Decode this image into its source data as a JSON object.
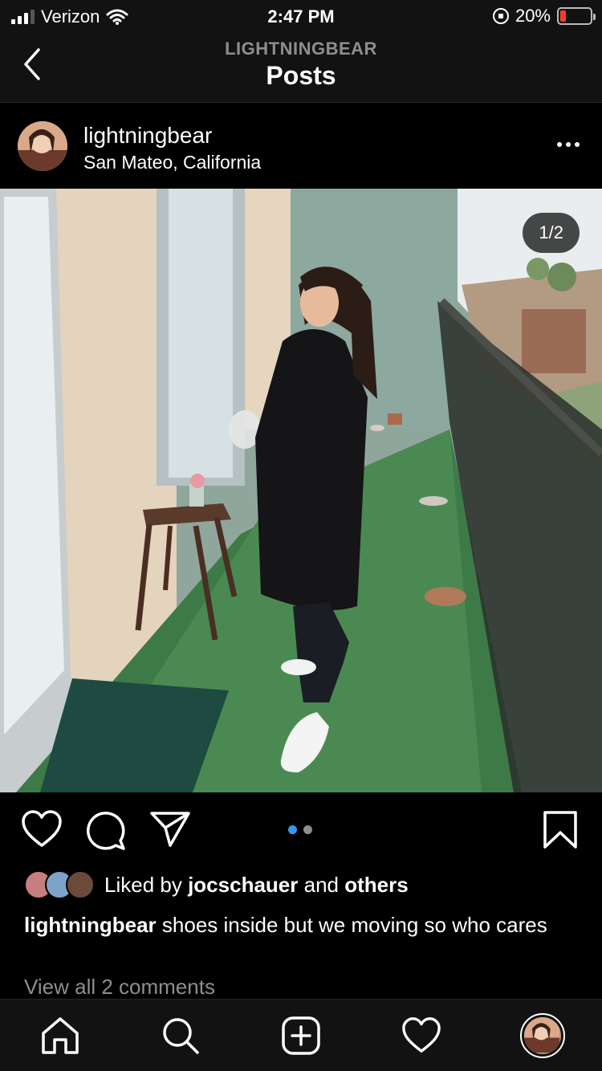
{
  "status_bar": {
    "carrier": "Verizon",
    "time": "2:47 PM",
    "battery": "20%",
    "battery_level": 0.2
  },
  "nav": {
    "username": "LIGHTNINGBEAR",
    "title": "Posts",
    "back_icon": "chevron-left-icon"
  },
  "post": {
    "username": "lightningbear",
    "location": "San Mateo, California",
    "photo_counter": "1/2",
    "carousel": {
      "count": 2,
      "active_index": 0
    },
    "liked_by_prefix": "Liked by",
    "liked_by_user": "jocschauer",
    "liked_by_and": "and",
    "liked_by_others": "others",
    "caption_user": "lightningbear",
    "caption_text": "shoes inside but we moving so who cares",
    "view_comments": "View all 2 comments"
  },
  "icons": {
    "like": "heart-icon",
    "comment": "comment-icon",
    "share": "send-icon",
    "save": "bookmark-icon",
    "more": "more-dots-icon"
  },
  "tab_bar": {
    "items": [
      "home-icon",
      "search-icon",
      "new-post-icon",
      "activity-heart-icon",
      "profile-avatar"
    ]
  },
  "colors": {
    "background": "#000000",
    "bar_background": "#121212",
    "active_dot": "#3897f0",
    "muted_text": "#8e8e8e",
    "battery_low": "#ff3b30"
  }
}
